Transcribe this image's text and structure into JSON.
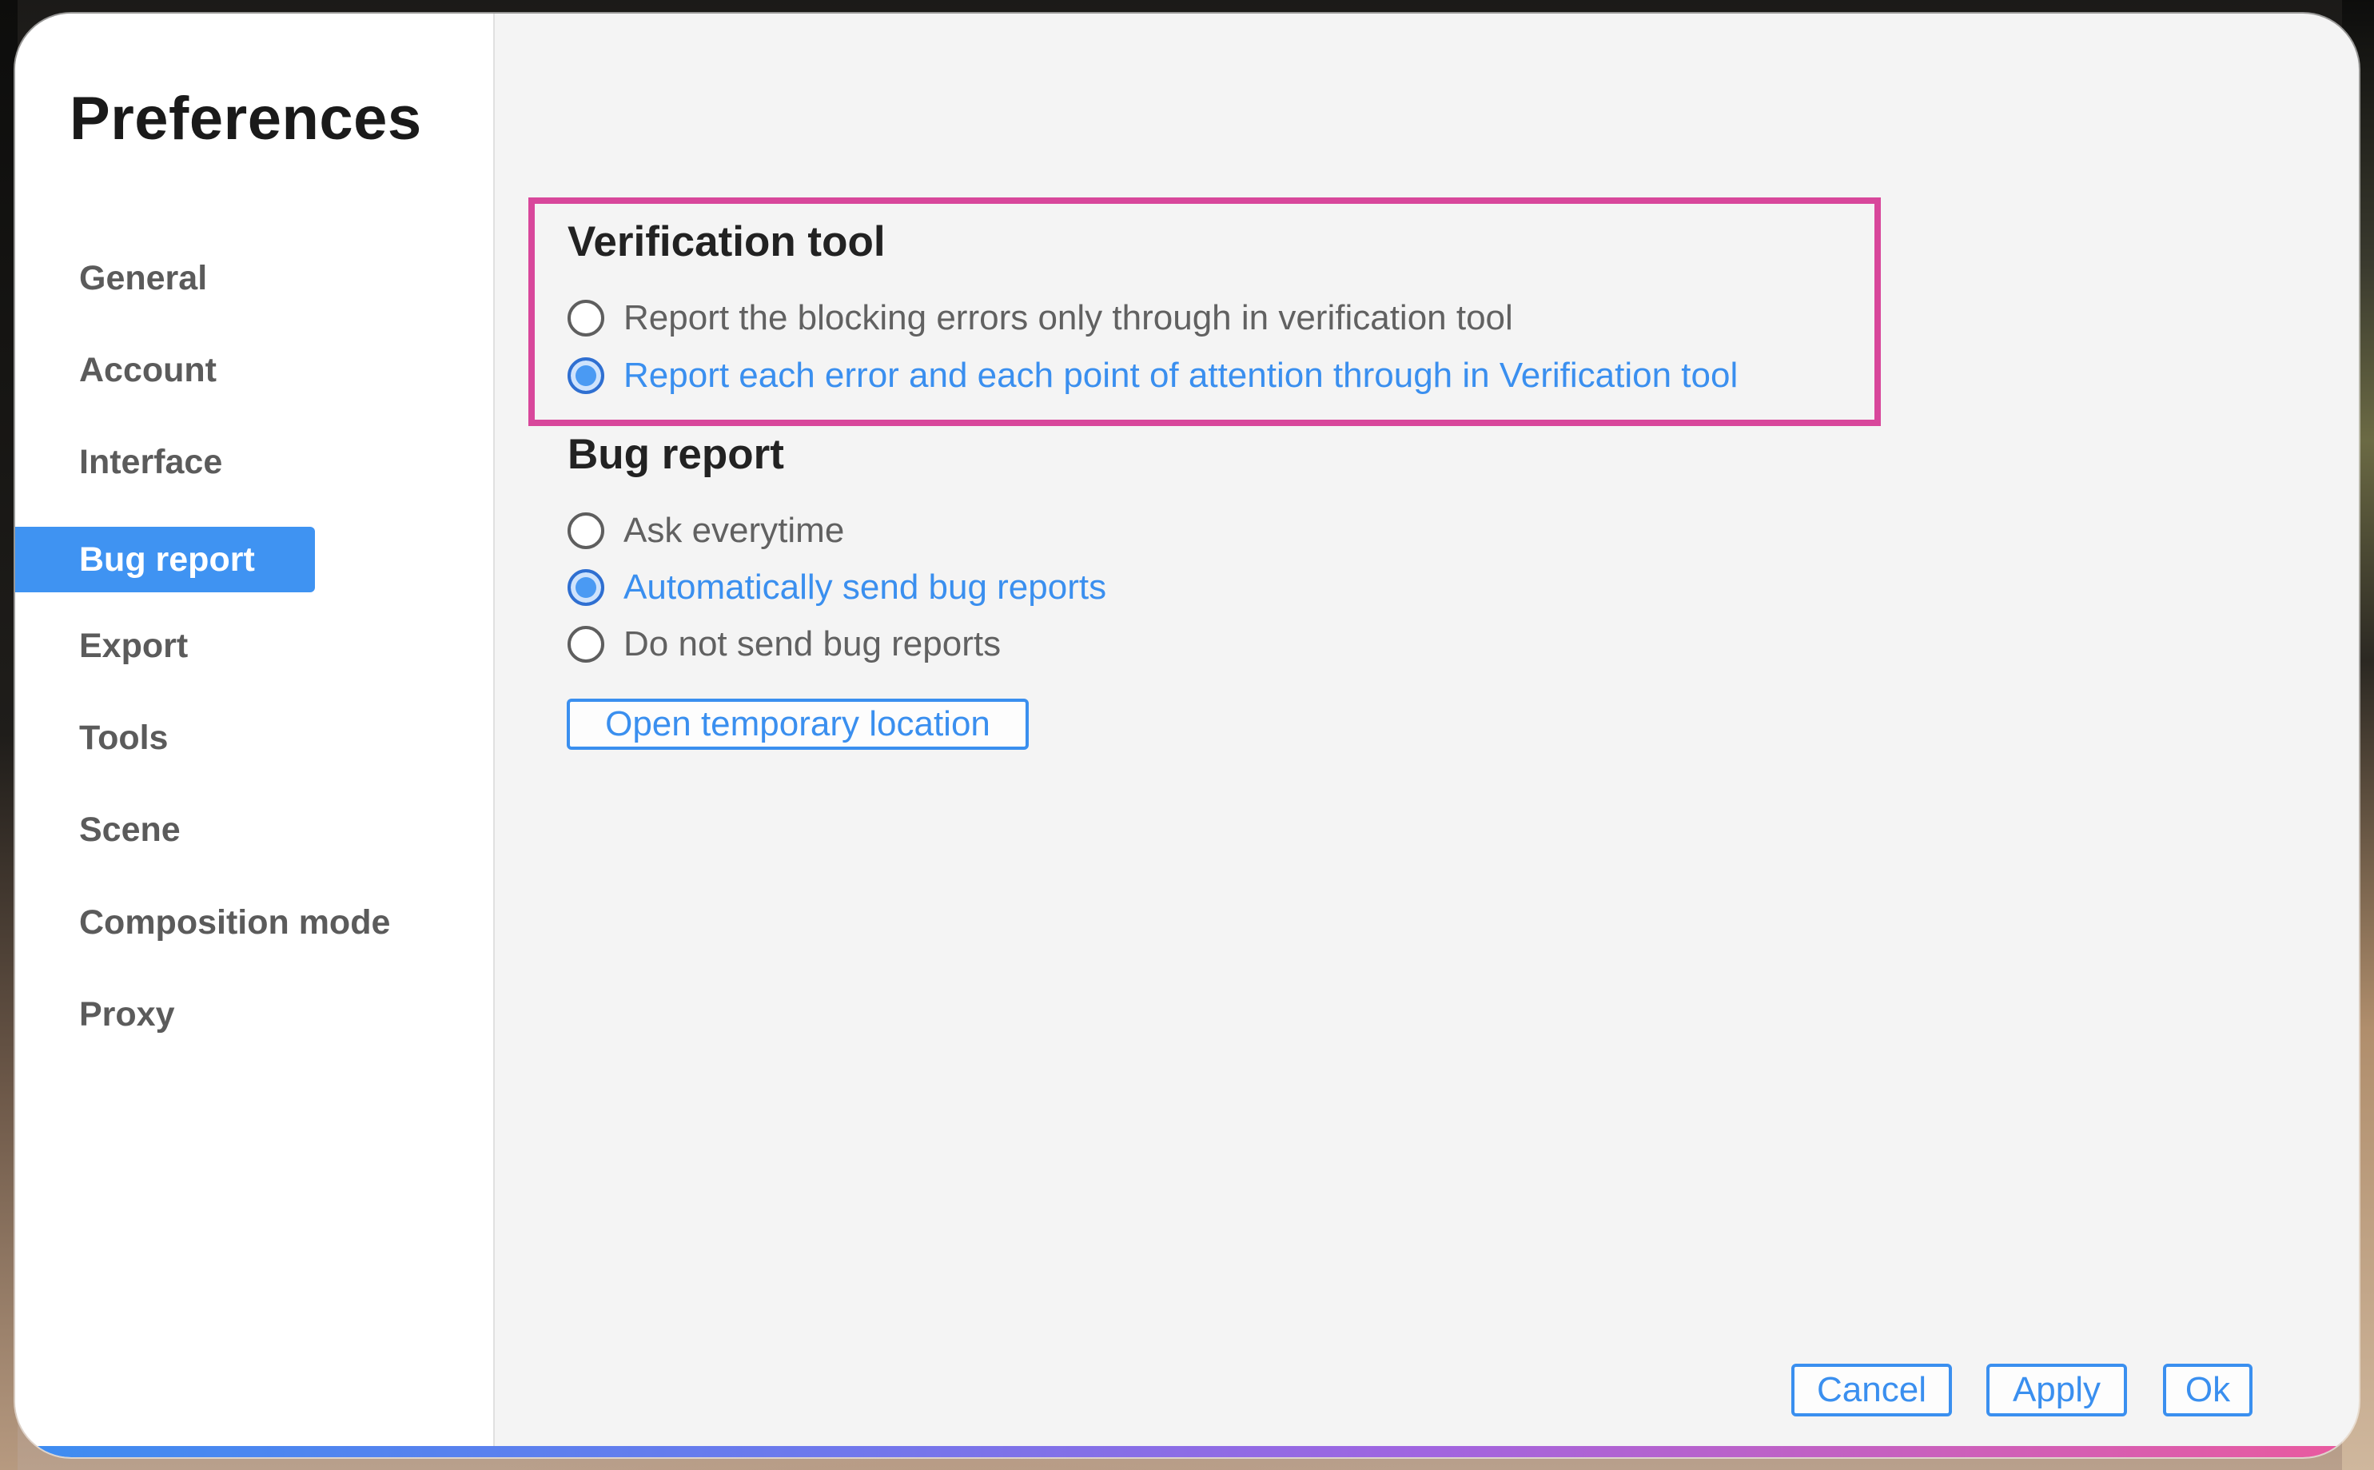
{
  "window": {
    "title": "Preferences"
  },
  "sidebar": {
    "items": [
      {
        "label": "General"
      },
      {
        "label": "Account"
      },
      {
        "label": "Interface"
      },
      {
        "label": "Bug report",
        "active": true
      },
      {
        "label": "Export"
      },
      {
        "label": "Tools"
      },
      {
        "label": "Scene"
      },
      {
        "label": "Composition mode"
      },
      {
        "label": "Proxy"
      }
    ]
  },
  "verification": {
    "title": "Verification tool",
    "options": [
      {
        "label": "Report the blocking errors only through in verification tool",
        "selected": false
      },
      {
        "label": "Report each error and each point of attention through in Verification tool",
        "selected": true
      }
    ]
  },
  "bug_report": {
    "title": "Bug report",
    "options": [
      {
        "label": "Ask everytime",
        "selected": false
      },
      {
        "label": "Automatically send bug reports",
        "selected": true
      },
      {
        "label": "Do not send bug reports",
        "selected": false
      }
    ],
    "open_location_label": "Open temporary location"
  },
  "footer": {
    "cancel_label": "Cancel",
    "apply_label": "Apply",
    "ok_label": "Ok"
  },
  "colors": {
    "accent": "#3f93f2",
    "highlight": "#d8479b",
    "panel": "#f4f4f4",
    "sidebar": "#ffffff"
  },
  "icons": {
    "radio_unchecked": "radio-unchecked-icon",
    "radio_checked": "radio-checked-icon"
  }
}
